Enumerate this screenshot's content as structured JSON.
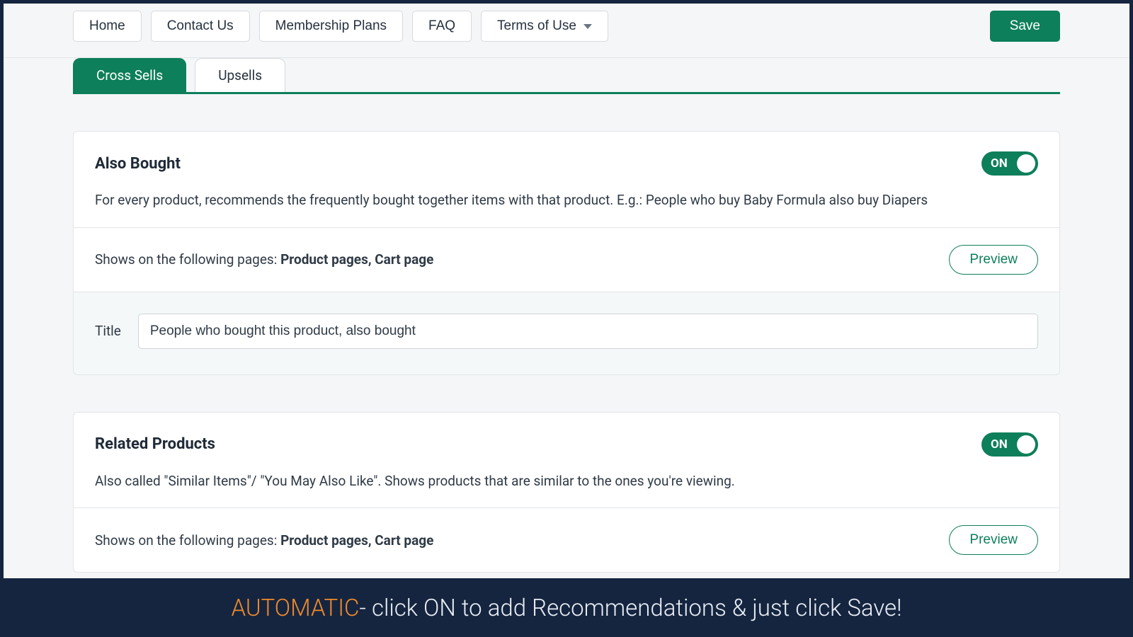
{
  "nav": {
    "home": "Home",
    "contact": "Contact Us",
    "membership": "Membership Plans",
    "faq": "FAQ",
    "terms": "Terms of Use",
    "save": "Save"
  },
  "tabs": {
    "cross_sells": "Cross Sells",
    "upsells": "Upsells"
  },
  "also_bought": {
    "title": "Also Bought",
    "toggle_label": "ON",
    "desc": "For every product, recommends the frequently bought together items with that product. E.g.: People who buy Baby Formula also buy Diapers",
    "shows_prefix": "Shows on the following pages: ",
    "shows_pages": "Product pages, Cart page",
    "preview": "Preview",
    "title_label": "Title",
    "title_value": "People who bought this product, also bought"
  },
  "related": {
    "title": "Related Products",
    "toggle_label": "ON",
    "desc": "Also called \"Similar Items\"/ \"You May Also Like\". Shows products that are similar to the ones you're viewing.",
    "shows_prefix": "Shows on the following pages: ",
    "shows_pages": "Product pages, Cart page",
    "preview": "Preview"
  },
  "footer": {
    "highlight": "AUTOMATIC",
    "rest": " - click ON to add Recommendations & just click Save!"
  }
}
